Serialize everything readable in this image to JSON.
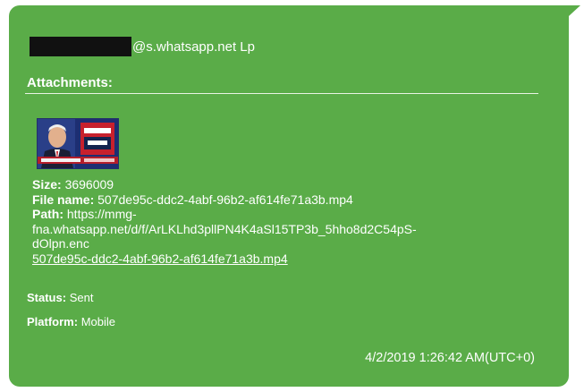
{
  "message": {
    "sender_suffix": "@s.whatsapp.net Lp",
    "attachments_label": "Attachments:",
    "attachment": {
      "size_label": "Size:",
      "size_value": "3696009",
      "filename_label": "File name:",
      "filename_value": "507de95c-ddc2-4abf-96b2-af614fe71a3b.mp4",
      "path_label": "Path:",
      "path_line1": "https://mmg-",
      "path_line2": "fna.whatsapp.net/d/f/ArLKLhd3pllPN4K4aSl15TP3b_5hho8d2C54pS-",
      "path_line3": "dOlpn.enc",
      "link_text": "507de95c-ddc2-4abf-96b2-af614fe71a3b.mp4",
      "thumbnail_icon": "video-thumbnail-icon"
    },
    "status_label": "Status:",
    "status_value": "Sent",
    "platform_label": "Platform:",
    "platform_value": "Mobile",
    "timestamp": "4/2/2019 1:26:42 AM(UTC+0)"
  },
  "colors": {
    "bubble": "#5aac48",
    "text": "#ffffff",
    "redaction": "#111111"
  }
}
